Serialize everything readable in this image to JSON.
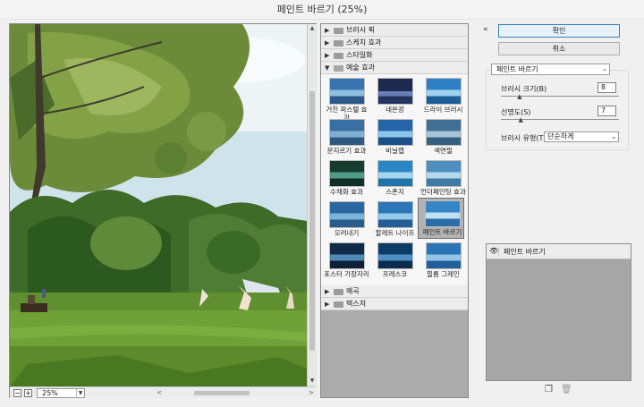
{
  "window": {
    "title": "페인트 바르기 (25%)"
  },
  "preview": {
    "zoom": "25%",
    "zoom_out_label": "−",
    "zoom_in_label": "+",
    "scroll_up": "▲",
    "scroll_down": "▼",
    "scroll_left": "<",
    "scroll_right": ">"
  },
  "gallery": {
    "categories": [
      {
        "label": "브러시 획",
        "expanded": false
      },
      {
        "label": "스케치 효과",
        "expanded": false
      },
      {
        "label": "스타일화",
        "expanded": false
      },
      {
        "label": "예술 효과",
        "expanded": true
      }
    ],
    "filters": [
      {
        "label": "거친 파스텔 효과"
      },
      {
        "label": "네온광"
      },
      {
        "label": "드라이 브러시"
      },
      {
        "label": "문지르기 효과"
      },
      {
        "label": "비닐랩"
      },
      {
        "label": "색연필"
      },
      {
        "label": "수채화 효과"
      },
      {
        "label": "스폰지"
      },
      {
        "label": "언더페인팅 효과"
      },
      {
        "label": "오려내기"
      },
      {
        "label": "팔레트 나이프"
      },
      {
        "label": "페인트 바르기",
        "selected": true
      },
      {
        "label": "포스터 가장자리"
      },
      {
        "label": "프레스코"
      },
      {
        "label": "필름 그레인"
      }
    ],
    "after_categories": [
      {
        "label": "왜곡",
        "expanded": false
      },
      {
        "label": "텍스처",
        "expanded": false
      }
    ],
    "arrow_collapsed": "▶",
    "arrow_expanded": "▼"
  },
  "panel": {
    "collapse_icon": "«",
    "ok_label": "확인",
    "cancel_label": "취소",
    "filter_select": "페인트 바르기",
    "params": {
      "brush_size_label": "브러시 크기(B)",
      "brush_size_value": "8",
      "brush_size_fraction": 0.16,
      "sharpness_label": "선명도(S)",
      "sharpness_value": "7",
      "sharpness_fraction": 0.17,
      "brush_type_label": "브러시 유형(T):",
      "brush_type_value": "단순하게"
    },
    "layers": [
      {
        "label": "페인트 바르기",
        "visible": true
      }
    ],
    "new_layer_icon": "new-layer-icon",
    "delete_icon": "trash-icon"
  },
  "colors": {
    "selected_bg": "#b3b3b3",
    "ok_border": "#3c7fb1",
    "gallery_bg": "#ababab"
  }
}
